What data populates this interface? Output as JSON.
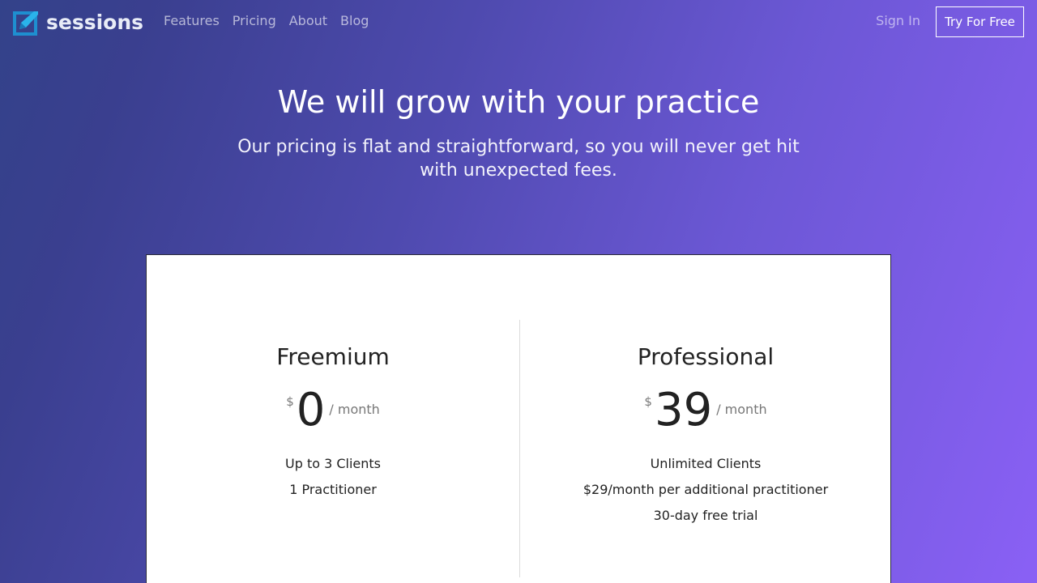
{
  "nav": {
    "logo_text": "sessions",
    "links": [
      "Features",
      "Pricing",
      "About",
      "Blog"
    ],
    "sign_in": "Sign In",
    "cta": "Try For Free"
  },
  "hero": {
    "title": "We will grow with your practice",
    "subtitle": "Our pricing is flat and straightforward, so you will never get hit with unexpected fees."
  },
  "plans": [
    {
      "name": "Freemium",
      "currency": "$",
      "amount": "0",
      "period": "/ month",
      "features": [
        "Up to 3 Clients",
        "1 Practitioner"
      ]
    },
    {
      "name": "Professional",
      "currency": "$",
      "amount": "39",
      "period": "/ month",
      "features": [
        "Unlimited Clients",
        "$29/month per additional practitioner",
        "30-day free trial"
      ]
    }
  ],
  "colors": {
    "logo_blue": "#2aa7e0",
    "gradient_start": "#33428a",
    "gradient_end": "#8a60f5"
  },
  "icons": {
    "logo": "sessions-logo-icon"
  }
}
